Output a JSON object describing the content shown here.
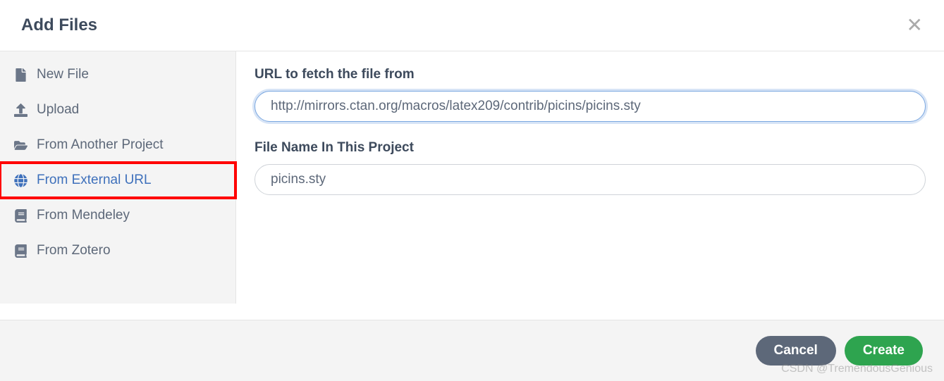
{
  "header": {
    "title": "Add Files"
  },
  "sidebar": {
    "items": [
      {
        "label": "New File",
        "icon": "file-icon",
        "active": false
      },
      {
        "label": "Upload",
        "icon": "upload-icon",
        "active": false
      },
      {
        "label": "From Another Project",
        "icon": "folder-open-icon",
        "active": false
      },
      {
        "label": "From External URL",
        "icon": "globe-icon",
        "active": true,
        "highlighted": true
      },
      {
        "label": "From Mendeley",
        "icon": "book-icon",
        "active": false
      },
      {
        "label": "From Zotero",
        "icon": "book-icon",
        "active": false
      }
    ]
  },
  "main": {
    "url_label": "URL to fetch the file from",
    "url_value": "http://mirrors.ctan.org/macros/latex209/contrib/picins/picins.sty",
    "filename_label": "File Name In This Project",
    "filename_value": "picins.sty"
  },
  "footer": {
    "cancel_label": "Cancel",
    "create_label": "Create"
  },
  "watermark": "CSDN @TremendousGenious"
}
